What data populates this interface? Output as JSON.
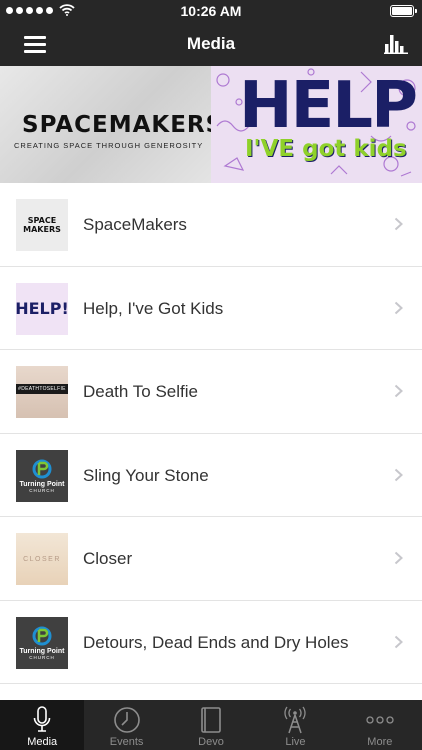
{
  "status_bar": {
    "time": "10:26 AM"
  },
  "nav": {
    "title": "Media"
  },
  "banners": {
    "spacemakers": {
      "logo": "SPACEMAKERS",
      "tagline": "CREATING SPACE THROUGH GENEROSITY"
    },
    "help": {
      "title": "HELP!",
      "subtitle": "I'VE got kids"
    }
  },
  "list": [
    {
      "label": "SpaceMakers",
      "thumb_text": "SPACE MAKERS"
    },
    {
      "label": "Help, I've Got Kids",
      "thumb_text": "HELP!"
    },
    {
      "label": "Death To Selfie",
      "thumb_text": "#DEATHTOSELFIE"
    },
    {
      "label": "Sling Your Stone",
      "thumb_text": "Turning Point",
      "thumb_sub": "CHURCH"
    },
    {
      "label": "Closer",
      "thumb_text": "CLOSER"
    },
    {
      "label": "Detours, Dead Ends and Dry Holes",
      "thumb_text": "Turning Point",
      "thumb_sub": "CHURCH"
    }
  ],
  "tabs": [
    {
      "label": "Media",
      "icon": "microphone-icon",
      "active": true
    },
    {
      "label": "Events",
      "icon": "clock-icon"
    },
    {
      "label": "Devo",
      "icon": "book-icon"
    },
    {
      "label": "Live",
      "icon": "broadcast-tower-icon"
    },
    {
      "label": "More",
      "icon": "ellipsis-icon"
    }
  ],
  "colors": {
    "bar": "#272727",
    "active_tab": "#171717",
    "help_navy": "#1b1f66",
    "help_green": "#8fd12a",
    "tp_blue": "#1f8fd1"
  }
}
